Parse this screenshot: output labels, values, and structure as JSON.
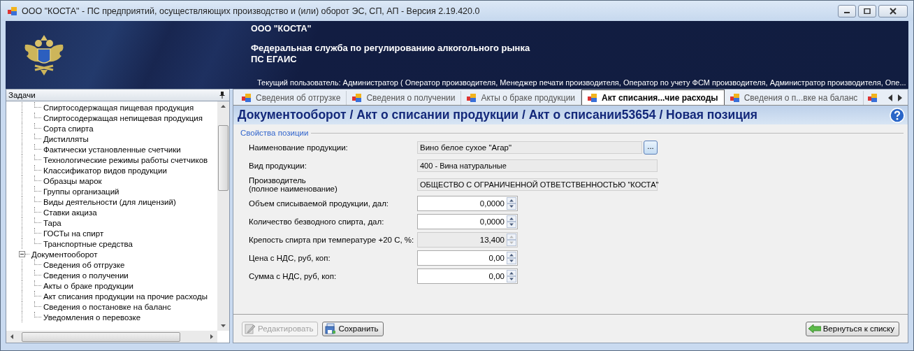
{
  "window": {
    "title": "ООО \"КОСТА\" - ПС предприятий, осуществляющих производство и (или) оборот ЭС, СП, АП - Версия 2.19.420.0"
  },
  "banner": {
    "organization": "ООО \"КОСТА\"",
    "agency": "Федеральная служба по регулированию алкогольного рынка",
    "system": "ПС ЕГАИС",
    "current_user": "Текущий пользователь: Администратор ( Оператор производителя, Менеджер печати производителя, Оператор по учету ФСМ производителя, Администратор производителя, Опе..."
  },
  "sidebar": {
    "title": "Задачи",
    "tree": [
      {
        "kind": "continuation",
        "children": [
          {
            "label": "Спиртосодержащая пищевая продукция",
            "selected": false
          },
          {
            "label": "Спиртосодержащая непищевая продукция",
            "selected": false
          },
          {
            "label": "Сорта спирта",
            "selected": false
          },
          {
            "label": "Дистилляты",
            "selected": false
          },
          {
            "label": "Фактически установленные счетчики",
            "selected": false
          },
          {
            "label": "Технологические режимы работы счетчиков",
            "selected": false
          },
          {
            "label": "Классификатор видов продукции",
            "selected": false
          },
          {
            "label": "Образцы марок",
            "selected": false
          },
          {
            "label": "Группы организаций",
            "selected": false
          },
          {
            "label": "Виды деятельности (для лицензий)",
            "selected": false
          },
          {
            "label": "Ставки акциза",
            "selected": false
          },
          {
            "label": "Тара",
            "selected": false
          },
          {
            "label": "ГОСТы на спирт",
            "selected": false
          },
          {
            "label": "Транспортные средства",
            "selected": false
          }
        ]
      },
      {
        "kind": "group",
        "label": "Документооборот",
        "expanded": true,
        "children": [
          {
            "label": "Сведения об отгрузке",
            "selected": false
          },
          {
            "label": "Сведения о получении",
            "selected": false
          },
          {
            "label": "Акты о браке продукции",
            "selected": false
          },
          {
            "label": "Акт списания продукции на прочие расходы",
            "selected": false
          },
          {
            "label": "Сведения о постановке на баланс",
            "selected": false
          },
          {
            "label": "Уведомления о перевозке",
            "selected": false
          }
        ]
      }
    ]
  },
  "tabs": [
    {
      "label": "Сведения об отгрузке",
      "selected": false
    },
    {
      "label": "Сведения о получении",
      "selected": false
    },
    {
      "label": "Акты о браке продукции",
      "selected": false
    },
    {
      "label": "Акт списания...чие расходы",
      "selected": true
    },
    {
      "label": "Сведения о п...вке на баланс",
      "selected": false
    },
    {
      "selected": false
    }
  ],
  "page": {
    "heading": "Документооборот / Акт о списании продукции / Акт о списании53654 / Новая позиция"
  },
  "form": {
    "group_title": "Свойства позиции",
    "fields": [
      {
        "kind": "lookup",
        "label": "Наименование продукции:",
        "value": "Вино белое сухое \"Агар\"",
        "button": "..."
      },
      {
        "kind": "readonly",
        "label": "Вид продукции:",
        "value": "400 - Вина натуральные"
      },
      {
        "kind": "readonly",
        "label": "Производитель\n(полное наименование)",
        "value": "ОБЩЕСТВО С ОГРАНИЧЕННОЙ ОТВЕТСТВЕННОСТЬЮ \"КОСТА\""
      },
      {
        "kind": "spin",
        "label": "Объем списываемой продукции, дал:",
        "value": "0,0000",
        "disabled": false
      },
      {
        "kind": "spin",
        "label": "Количество безводного спирта, дал:",
        "value": "0,0000",
        "disabled": false
      },
      {
        "kind": "spin",
        "label": "Крепость спирта при температуре +20 С, %:",
        "value": "13,400",
        "disabled": true
      },
      {
        "kind": "spin",
        "label": "Цена с НДС, руб, коп:",
        "value": "0,00",
        "disabled": false
      },
      {
        "kind": "spin",
        "label": "Сумма с НДС, руб, коп:",
        "value": "0,00",
        "disabled": false
      }
    ]
  },
  "buttons": [
    {
      "kind": "edit",
      "label": "Редактировать",
      "disabled": true
    },
    {
      "kind": "save",
      "label": "Сохранить",
      "disabled": false
    },
    {
      "kind": "back",
      "label": "Вернуться к списку",
      "disabled": false
    }
  ]
}
